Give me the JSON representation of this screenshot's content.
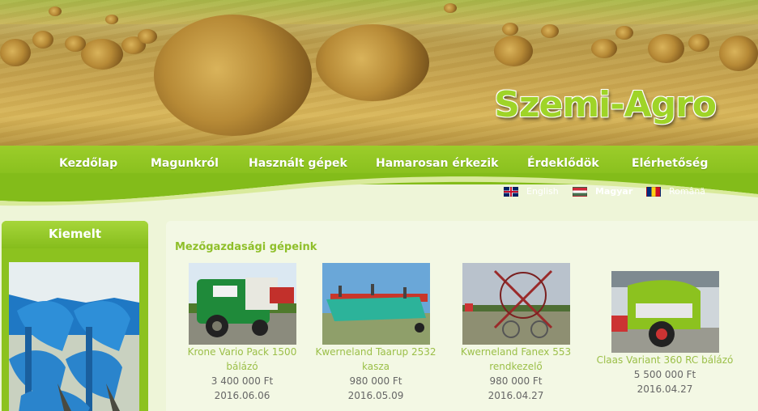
{
  "site": {
    "logo_text": "Szemi-Agro"
  },
  "nav": {
    "items": [
      {
        "label": "Kezdőlap"
      },
      {
        "label": "Magunkról"
      },
      {
        "label": "Használt gépek"
      },
      {
        "label": "Hamarosan érkezik"
      },
      {
        "label": "Érdeklődök"
      },
      {
        "label": "Elérhetőség"
      }
    ]
  },
  "languages": [
    {
      "label": "English",
      "flag": "uk-flag-icon",
      "active": false
    },
    {
      "label": "Magyar",
      "flag": "hu-flag-icon",
      "active": true
    },
    {
      "label": "Română",
      "flag": "ro-flag-icon",
      "active": false
    }
  ],
  "sidebar": {
    "title": "Kiemelt"
  },
  "main": {
    "section_title": "Mezőgazdasági gépeink",
    "products": [
      {
        "name_line1": "Krone Vario Pack 1500",
        "name_line2": "bálázó",
        "price": "3 400 000 Ft",
        "date": "2016.06.06"
      },
      {
        "name_line1": "Kwerneland Taarup 2532",
        "name_line2": "kasza",
        "price": "980 000 Ft",
        "date": "2016.05.09"
      },
      {
        "name_line1": "Kwerneland Fanex 553",
        "name_line2": "rendkezelő",
        "price": "980 000 Ft",
        "date": "2016.04.27"
      },
      {
        "name_line1": "Claas Variant 360 RC bálázó",
        "name_line2": "",
        "price": "5 500 000 Ft",
        "date": "2016.04.27"
      }
    ]
  },
  "colors": {
    "accent_green": "#8cc21f",
    "link_green": "#9bbf48",
    "logo_green": "#9fd428"
  }
}
